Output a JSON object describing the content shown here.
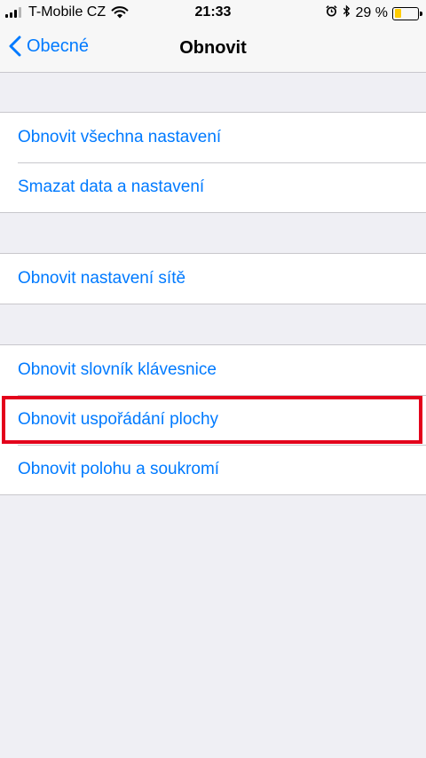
{
  "status_bar": {
    "carrier": "T-Mobile CZ",
    "time": "21:33",
    "battery_percent": "29 %",
    "battery_level": 0.29,
    "signal_bars": 3,
    "icons": [
      "signal-icon",
      "wifi-icon",
      "alarm-icon",
      "bluetooth-icon",
      "battery-icon"
    ]
  },
  "nav": {
    "back_label": "Obecné",
    "title": "Obnovit"
  },
  "groups": [
    {
      "items": [
        {
          "label": "Obnovit všechna nastavení"
        },
        {
          "label": "Smazat data a nastavení"
        }
      ]
    },
    {
      "items": [
        {
          "label": "Obnovit nastavení sítě"
        }
      ]
    },
    {
      "items": [
        {
          "label": "Obnovit slovník klávesnice"
        },
        {
          "label": "Obnovit uspořádání plochy",
          "highlighted": true
        },
        {
          "label": "Obnovit polohu a soukromí"
        }
      ]
    }
  ],
  "colors": {
    "accent": "#007aff",
    "background": "#efeff4",
    "highlight_border": "#e3001b",
    "battery_fill": "#ffcc00"
  }
}
